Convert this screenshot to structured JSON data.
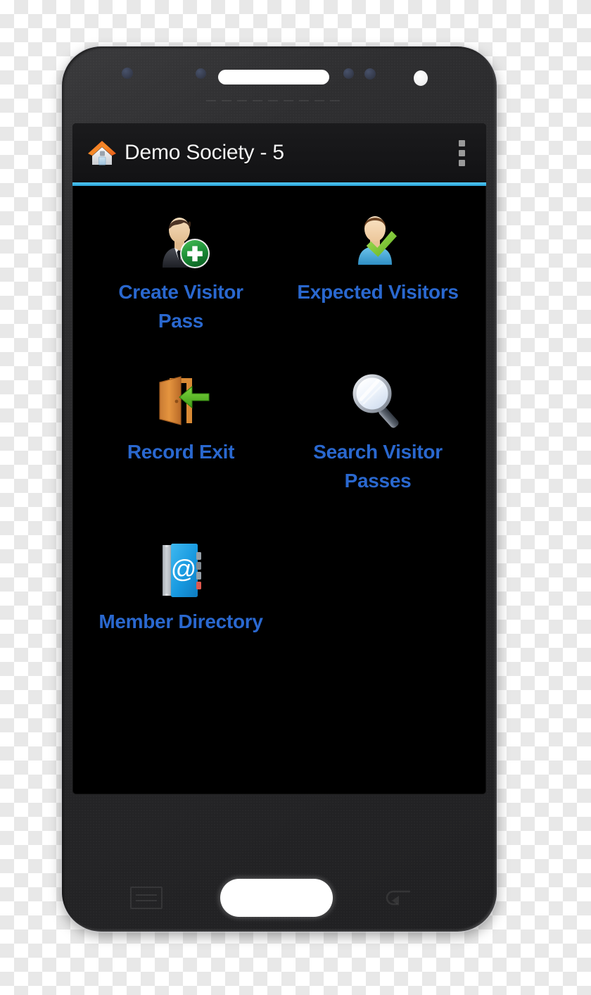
{
  "device": {
    "name": "android-smartphone",
    "hardware": {
      "earpiece_speaker": "earpiece-speaker",
      "front_camera": "front-camera",
      "home_button": "home-button",
      "menu_key": "menu-key-icon",
      "back_key": "back-key-icon"
    }
  },
  "app": {
    "title": "Demo Society - 5",
    "home_icon": "home-icon",
    "overflow_menu_label": "More options",
    "accent_color": "#33b5e5",
    "label_color": "#2a68cf",
    "screen_background": "#000000"
  },
  "menu": {
    "items": [
      {
        "id": "create-visitor-pass",
        "label": "Create Visitor Pass",
        "icon": "user-add-icon"
      },
      {
        "id": "expected-visitors",
        "label": "Expected Visitors",
        "icon": "user-check-icon"
      },
      {
        "id": "record-exit",
        "label": "Record Exit",
        "icon": "door-exit-icon"
      },
      {
        "id": "search-visitor-passes",
        "label": "Search Visitor Passes",
        "icon": "magnifier-icon"
      },
      {
        "id": "member-directory",
        "label": "Member Directory",
        "icon": "address-book-icon"
      }
    ]
  }
}
